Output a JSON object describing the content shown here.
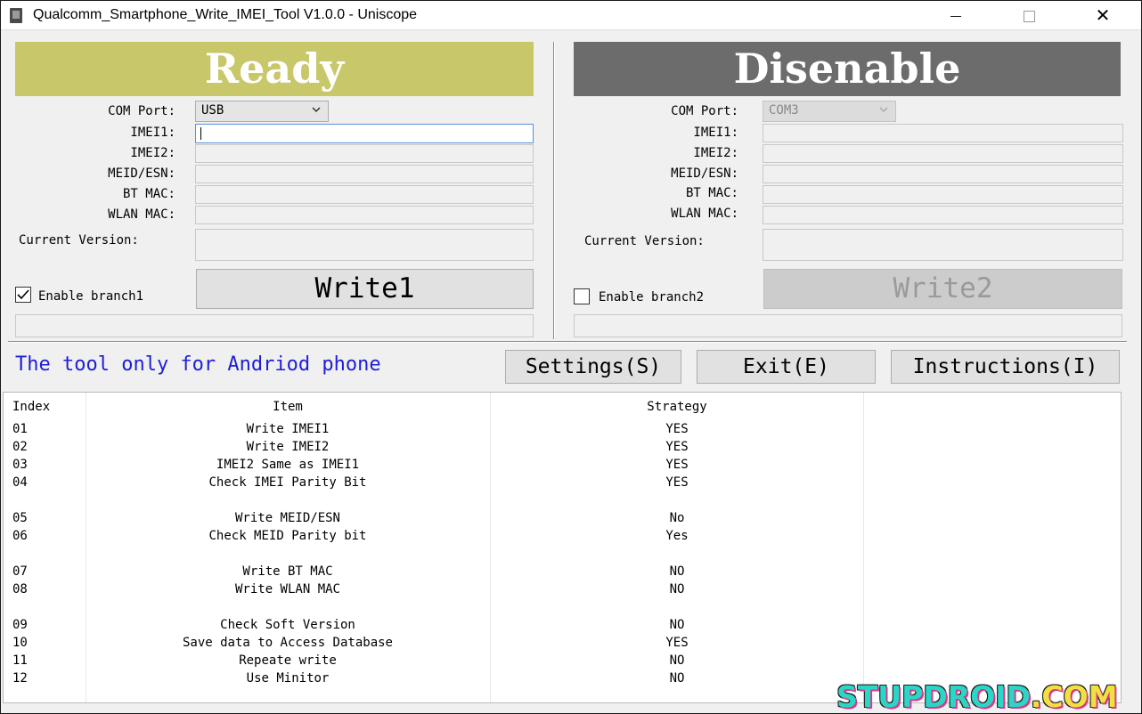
{
  "window": {
    "title": "Qualcomm_Smartphone_Write_IMEI_Tool V1.0.0  - Uniscope",
    "close_glyph": "✕"
  },
  "panel1": {
    "status": "Ready",
    "status_color": "#c8c76a",
    "com_port_label": "COM Port:",
    "com_port_value": "USB",
    "imei1_label": "IMEI1:",
    "imei2_label": "IMEI2:",
    "meid_label": "MEID/ESN:",
    "bt_label": "BT MAC:",
    "wlan_label": "WLAN MAC:",
    "version_label": "Current Version:",
    "write_label": "Write1",
    "branch_label": "Enable branch1",
    "branch_checked": true
  },
  "panel2": {
    "status": "Disenable",
    "status_color": "#6c6c6c",
    "com_port_label": "COM Port:",
    "com_port_value": "COM3",
    "imei1_label": "IMEI1:",
    "imei2_label": "IMEI2:",
    "meid_label": "MEID/ESN:",
    "bt_label": "BT MAC:",
    "wlan_label": "WLAN MAC:",
    "version_label": "Current Version:",
    "write_label": "Write2",
    "branch_label": "Enable branch2",
    "branch_checked": false
  },
  "notice": "The tool only for Andriod phone",
  "actions": {
    "settings": "Settings(S)",
    "exit": "Exit(E)",
    "instructions": "Instructions(I)"
  },
  "table": {
    "headers": [
      "Index",
      "Item",
      "Strategy"
    ],
    "rows": [
      {
        "index": "01",
        "item": "Write IMEI1",
        "strategy": "YES"
      },
      {
        "index": "02",
        "item": "Write IMEI2",
        "strategy": "YES"
      },
      {
        "index": "03",
        "item": "IMEI2 Same as IMEI1",
        "strategy": "YES"
      },
      {
        "index": "04",
        "item": "Check IMEI Parity Bit",
        "strategy": "YES"
      },
      {
        "index": "",
        "item": "",
        "strategy": ""
      },
      {
        "index": "05",
        "item": "Write MEID/ESN",
        "strategy": "No"
      },
      {
        "index": "06",
        "item": "Check MEID Parity bit",
        "strategy": "Yes"
      },
      {
        "index": "",
        "item": "",
        "strategy": ""
      },
      {
        "index": "07",
        "item": "Write BT MAC",
        "strategy": "NO"
      },
      {
        "index": "08",
        "item": "Write WLAN MAC",
        "strategy": "NO"
      },
      {
        "index": "",
        "item": "",
        "strategy": ""
      },
      {
        "index": "09",
        "item": "Check Soft Version",
        "strategy": "NO"
      },
      {
        "index": "10",
        "item": "Save data to Access Database",
        "strategy": "YES"
      },
      {
        "index": "11",
        "item": "Repeate write",
        "strategy": "NO"
      },
      {
        "index": "12",
        "item": "Use Minitor",
        "strategy": "NO"
      }
    ]
  },
  "watermark": {
    "part_a": "STUPDROID",
    "part_b": ".COM"
  }
}
